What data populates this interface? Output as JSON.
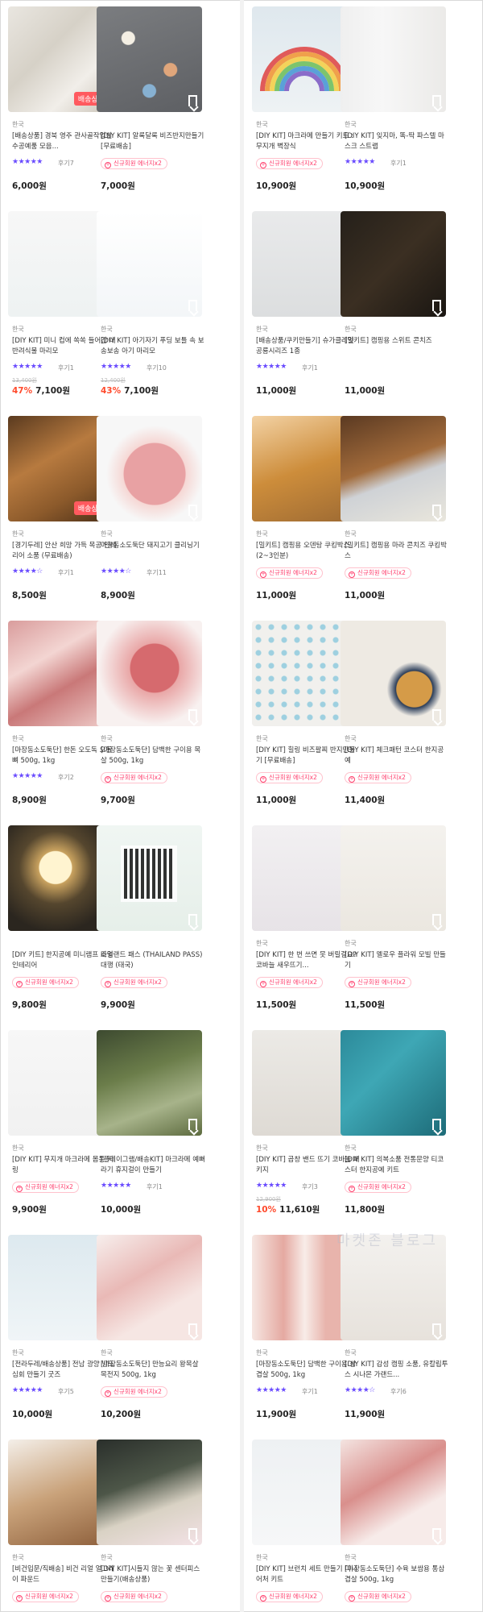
{
  "icons": {
    "bookmark": "bookmark-icon",
    "coupon": "coupon-icon",
    "star": "★"
  },
  "colors": {
    "accent": "#6a4cff",
    "discount": "#ff4a2c",
    "coupon": "#ff3e6c",
    "badge": "#ff5a5f"
  },
  "watermark": "마켓존 블로그",
  "columns": [
    {
      "cards": [
        {
          "badge": "배송상품",
          "origin": "한국",
          "title": "[배송상품] 경북 영주 관사골작업실 수공예품 모음...",
          "stars": "★★★★★",
          "reviews": "후기7",
          "price": "6,000원"
        },
        {
          "origin": "한국",
          "title": "[DIY KIT] 미니 컵에 쏙쏙 들어간 내 반려식물 마리모",
          "stars": "★★★★★",
          "reviews": "후기1",
          "old_price": "13,400원",
          "discount": "47%",
          "price": "7,100원"
        },
        {
          "badge": "배송상품",
          "origin": "한국",
          "title": "[경기두레] 안산 희망 가득 목공 인테리어 소품 (무료배송)",
          "stars": "★★★★☆",
          "reviews": "후기1",
          "price": "8,500원"
        },
        {
          "origin": "한국",
          "title": "[마장동소도둑단] 한돈 오도독 오돌뼈 500g, 1kg",
          "stars": "★★★★★",
          "reviews": "후기2",
          "price": "8,900원"
        },
        {
          "origin": "",
          "title": "[DIY 키트] 한지공예 미니램프 조명 인테리어",
          "coupon": "신규회원 에너지x2",
          "price": "9,800원"
        },
        {
          "origin": "한국",
          "title": "[DIY KIT] 무지개 마크라메 몸통 키링",
          "coupon": "신규회원 에너지x2",
          "price": "9,900원"
        },
        {
          "origin": "한국",
          "title": "[전라두레/배송상품] 전남 광양 남도심회 만들기 굿즈",
          "stars": "★★★★★",
          "reviews": "후기5",
          "price": "10,000원"
        },
        {
          "origin": "한국",
          "title": "[비건입문/직배송] 비건 리얼 얼그레이 파운드",
          "coupon": "신규회원 에너지x2",
          "price": ""
        }
      ]
    },
    {
      "cards": [
        {
          "origin": "",
          "title": "[DIY KIT] 알록달록 비즈반지만들기 [무료배송]",
          "coupon": "신규회원 에너지x2",
          "price": "7,000원"
        },
        {
          "origin": "한국",
          "title": "[DIY KIT] 아기자기 푸딩 보틀 속 보송보송 아기 마리모",
          "stars": "★★★★★",
          "reviews": "후기10",
          "old_price": "12,400원",
          "discount": "43%",
          "price": "7,100원"
        },
        {
          "origin": "한국",
          "title": "마장동소도둑단 돼지고기 클리닝기",
          "stars": "★★★★☆",
          "reviews": "후기11",
          "price": "8,900원"
        },
        {
          "origin": "한국",
          "title": "[마장동소도둑단] 담백한 구이용 목살 500g, 1kg",
          "coupon": "신규회원 에너지x2",
          "price": "9,700원"
        },
        {
          "origin": "",
          "title": "타일랜드 패스 (THAILAND PASS) 대행 (태국)",
          "coupon": "신규회원 에너지x2",
          "price": "9,900원"
        },
        {
          "origin": "",
          "title": "[플레이그램/배송KIT] 마크라메 예뻐라기 휴지걸이 만들기",
          "stars": "★★★★★",
          "reviews": "후기1",
          "price": "10,000원"
        },
        {
          "origin": "한국",
          "title": "[마장동소도둑단] 만능요리 왕목살 목전지 500g, 1kg",
          "coupon": "신규회원 에너지x2",
          "price": "10,200원"
        },
        {
          "origin": "한국",
          "title": "[DIY KIT]시들지 않는 꽃 센터피스 만들기(배송상품)",
          "coupon": "신규회원 에너지x2",
          "price": ""
        }
      ]
    },
    {
      "cards": [
        {
          "origin": "한국",
          "title": "[DIY KIT] 마크라메 만들기 키트 : 무지개 벽장식",
          "coupon": "신규회원 에너지x2",
          "price": "10,900원"
        },
        {
          "origin": "한국",
          "title": "[배송상품/쿠키만들기] 슈가클레잇 공룡시리즈 1종",
          "stars": "★★★★★",
          "reviews": "후기1",
          "price": "11,000원"
        },
        {
          "origin": "한국",
          "title": "[밀키트] 캠핑용 오덴탕 쿠킹박스 (2~3인분)",
          "coupon": "신규회원 에너지x2",
          "price": "11,000원"
        },
        {
          "origin": "한국",
          "title": "[DIY KIT] 힐링 비즈팔찌 반지만들기 [무료배송]",
          "coupon": "신규회원 에너지x2",
          "price": "11,000원"
        },
        {
          "origin": "한국",
          "title": "[DIY KIT] 한 번 쓰면 못 버릴걸요? 코바늘 새우뜨기...",
          "coupon": "신규회원 에너지x2",
          "price": "11,500원"
        },
        {
          "origin": "한국",
          "title": "[DIY KIT] 곱창 밴드 뜨기 코바늘 패키지",
          "stars": "★★★★★",
          "reviews": "후기3",
          "old_price": "12,900원",
          "discount": "10%",
          "price": "11,610원"
        },
        {
          "origin": "한국",
          "title": "[마장동소도둑단] 담백한 구이용 삼겹살 500g, 1kg",
          "stars": "★★★★★",
          "reviews": "후기1",
          "price": "11,900원"
        },
        {
          "origin": "한국",
          "title": "[DIY KIT] 브런치 세트 만들기 미니어처 키트",
          "coupon": "신규회원 에너지x2",
          "price": ""
        }
      ]
    },
    {
      "cards": [
        {
          "origin": "한국",
          "title": "[DIY KIT] 잊지마, 똑-딱 파스텔 마스크 스트랩",
          "stars": "★★★★★",
          "reviews": "후기1",
          "price": "10,900원"
        },
        {
          "origin": "한국",
          "title": "[밀키트] 캠핑용 스위트 콘치즈",
          "price": "11,000원"
        },
        {
          "origin": "한국",
          "title": "[밀키트] 캠핑용 마라 콘치즈 쿠킹박스",
          "coupon": "신규회원 에너지x2",
          "price": "11,000원"
        },
        {
          "origin": "한국",
          "title": "[DIY KIT] 체크패턴 코스터 한지공예",
          "coupon": "신규회원 에너지x2",
          "price": "11,400원"
        },
        {
          "origin": "한국",
          "title": "[DIY KIT] 멜로우 플라워 모빌 만들기",
          "coupon": "신규회원 에너지x2",
          "price": "11,500원"
        },
        {
          "origin": "한국",
          "title": "[DIY KIT] 의복소품 전통문양 티코스터 한지공예 키트",
          "coupon": "신규회원 에너지x2",
          "price": "11,800원"
        },
        {
          "origin": "한국",
          "title": "[DIY KIT] 감성 캠핑 소품, 유칼립투스 시나몬 가랜드...",
          "stars": "★★★★☆",
          "reviews": "후기6",
          "price": "11,900원"
        },
        {
          "origin": "한국",
          "title": "[마장동소도둑단] 수육 보쌈용 통삼겹살 500g, 1kg",
          "coupon": "신규회원 에너지x2",
          "price": ""
        }
      ]
    }
  ]
}
